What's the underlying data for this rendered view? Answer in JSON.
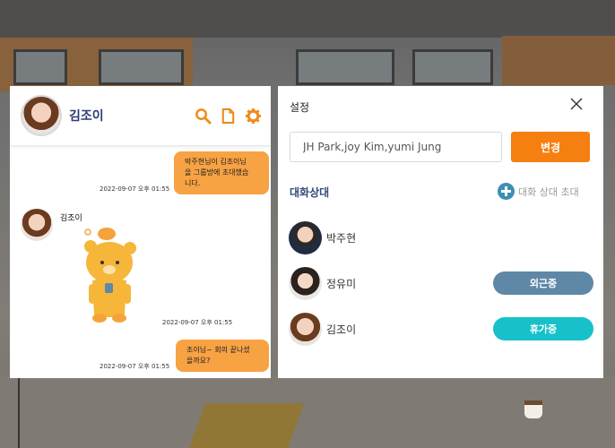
{
  "chat": {
    "title": "김조이",
    "messages": [
      {
        "text": "박주현님이 김조이님을 그룹방에 초대했습니다.",
        "line1": "박주현님이 김조이님",
        "line2": "을 그룹방에 초대했습",
        "line3": "니다.",
        "time": "2022-09-07 오후 01:55"
      },
      {
        "sender": "김조이",
        "time": "2022-09-07 오후 01:55"
      },
      {
        "line1": "조이님~ 회의 끝나셨",
        "line2": "을까요?",
        "time": "2022-09-07 오후 01:55"
      }
    ]
  },
  "settings": {
    "title": "설정",
    "participants_value": "JH Park,joy Kim,yumi Jung",
    "change_label": "변경",
    "section_label": "대화상대",
    "invite_label": "대화 상대 초대",
    "members": [
      {
        "name": "박주현",
        "status": ""
      },
      {
        "name": "정유미",
        "status": "외근중",
        "status_color": "#5f88a6"
      },
      {
        "name": "김조이",
        "status": "휴가중",
        "status_color": "#16c1c9"
      }
    ]
  },
  "colors": {
    "accent_orange": "#f57f10",
    "bubble_orange": "#f7a243",
    "title_navy": "#2f3b76"
  }
}
